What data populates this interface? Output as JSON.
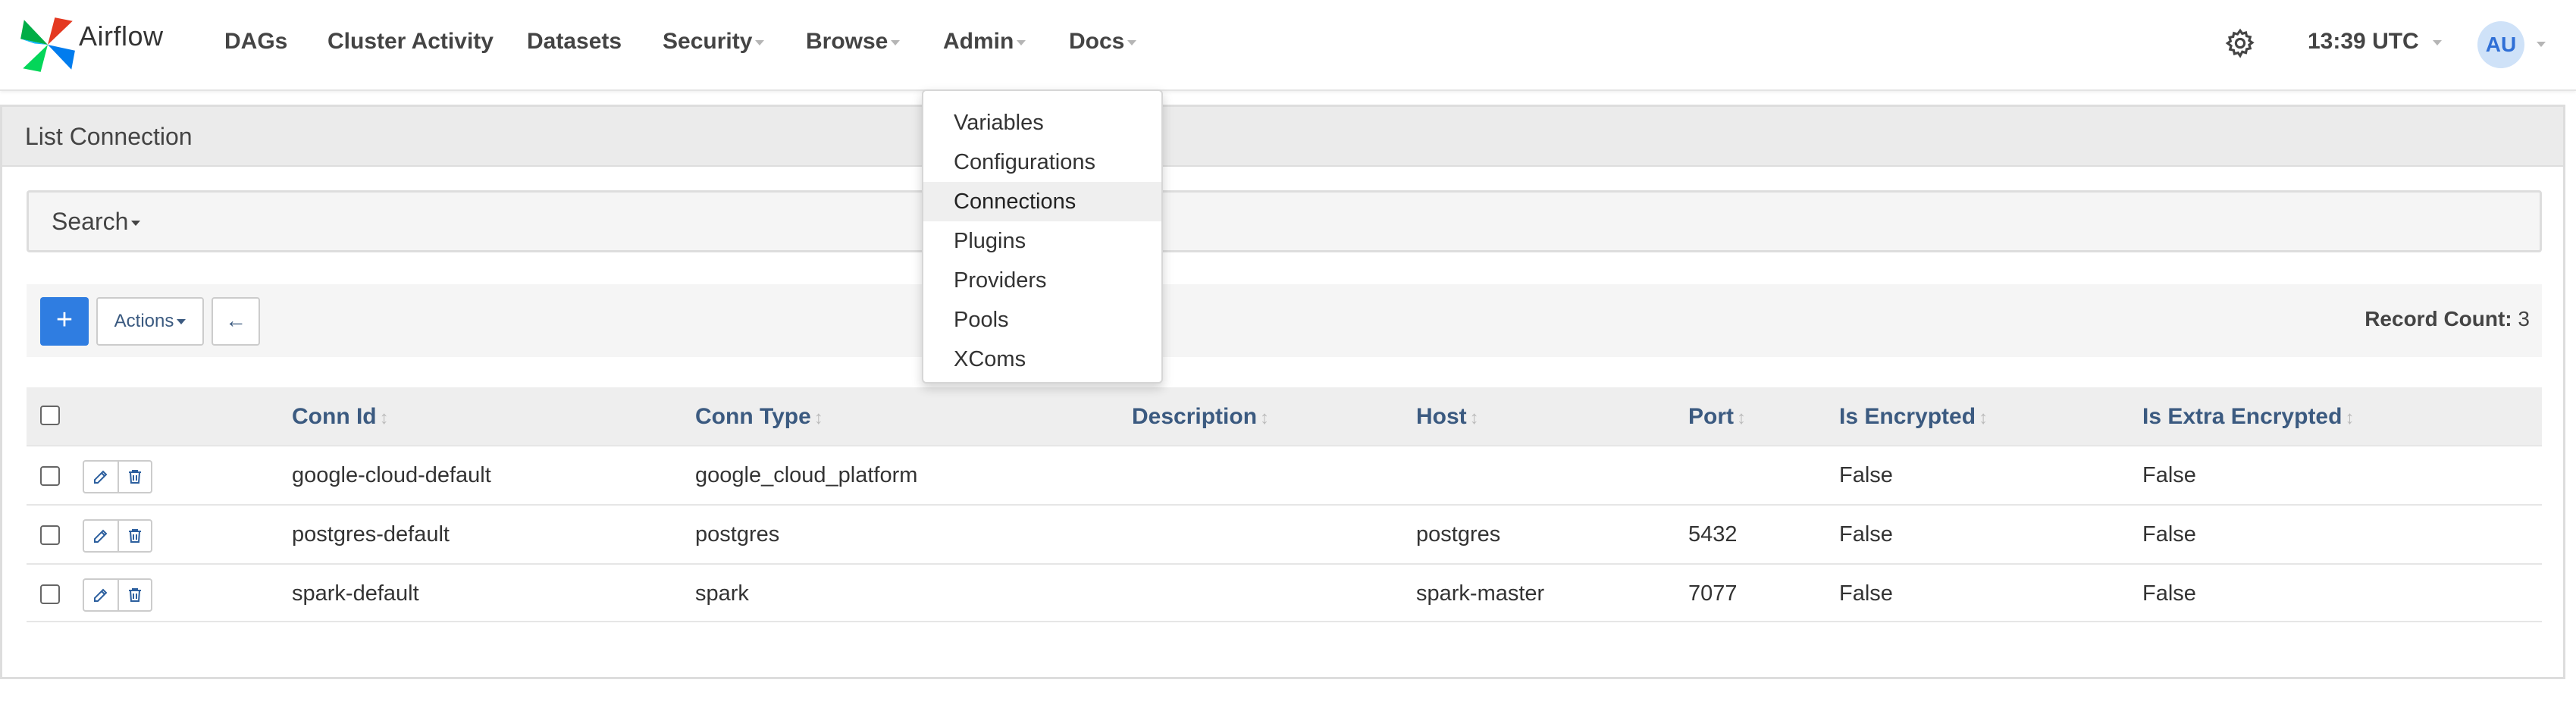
{
  "app": {
    "name": "Airflow"
  },
  "nav": {
    "dags": "DAGs",
    "cluster_activity": "Cluster Activity",
    "datasets": "Datasets",
    "security": "Security",
    "browse": "Browse",
    "admin": "Admin",
    "docs": "Docs",
    "time": "13:39 UTC",
    "user_initials": "AU"
  },
  "admin_menu": {
    "items": [
      "Variables",
      "Configurations",
      "Connections",
      "Plugins",
      "Providers",
      "Pools",
      "XComs"
    ],
    "selected": "Connections"
  },
  "page": {
    "title": "List Connection",
    "search_label": "Search",
    "add_label": "+",
    "actions_label": "Actions",
    "back_label": "←",
    "record_count_label": "Record Count:",
    "record_count": "3"
  },
  "table": {
    "columns": [
      "Conn Id",
      "Conn Type",
      "Description",
      "Host",
      "Port",
      "Is Encrypted",
      "Is Extra Encrypted"
    ],
    "rows": [
      [
        "google-cloud-default",
        "google_cloud_platform",
        "",
        "",
        "",
        "False",
        "False"
      ],
      [
        "postgres-default",
        "postgres",
        "",
        "postgres",
        "5432",
        "False",
        "False"
      ],
      [
        "spark-default",
        "spark",
        "",
        "spark-master",
        "7077",
        "False",
        "False"
      ]
    ]
  },
  "colors": {
    "accent": "#2f7de1",
    "link": "#3b5a80",
    "avatar_bg": "#cfe2f8"
  },
  "icons": {
    "logo": "airflow-pinwheel-icon",
    "settings": "gear-icon",
    "edit": "edit-icon",
    "delete": "trash-icon",
    "sort": "sort-icon"
  }
}
